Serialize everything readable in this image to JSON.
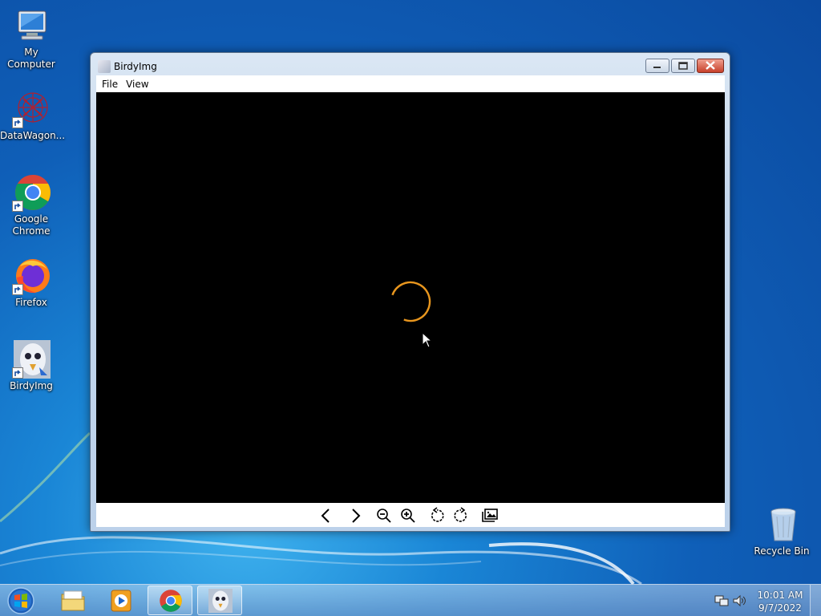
{
  "desktop": {
    "icons": [
      {
        "label": "My Computer",
        "icon": "computer-icon"
      },
      {
        "label": "DataWagon...",
        "icon": "datawagon-icon"
      },
      {
        "label": "Google Chrome",
        "icon": "chrome-icon"
      },
      {
        "label": "Firefox",
        "icon": "firefox-icon"
      },
      {
        "label": "BirdyImg",
        "icon": "birdyimg-icon"
      },
      {
        "label": "Recycle Bin",
        "icon": "recycle-bin-icon"
      }
    ]
  },
  "window": {
    "title": "BirdyImg",
    "menu": [
      "File",
      "View"
    ],
    "viewer_state": "loading",
    "toolbar": [
      "previous-icon",
      "next-icon",
      "zoom-out-icon",
      "zoom-in-icon",
      "rotate-left-icon",
      "rotate-right-icon",
      "gallery-icon"
    ]
  },
  "taskbar": {
    "apps": [
      "explorer",
      "media-player",
      "chrome",
      "birdyimg"
    ],
    "active_app": "birdyimg",
    "time": "10:01 AM",
    "date": "9/7/2022"
  },
  "colors": {
    "spinner": "#e8961e",
    "viewer_bg": "#000000"
  }
}
